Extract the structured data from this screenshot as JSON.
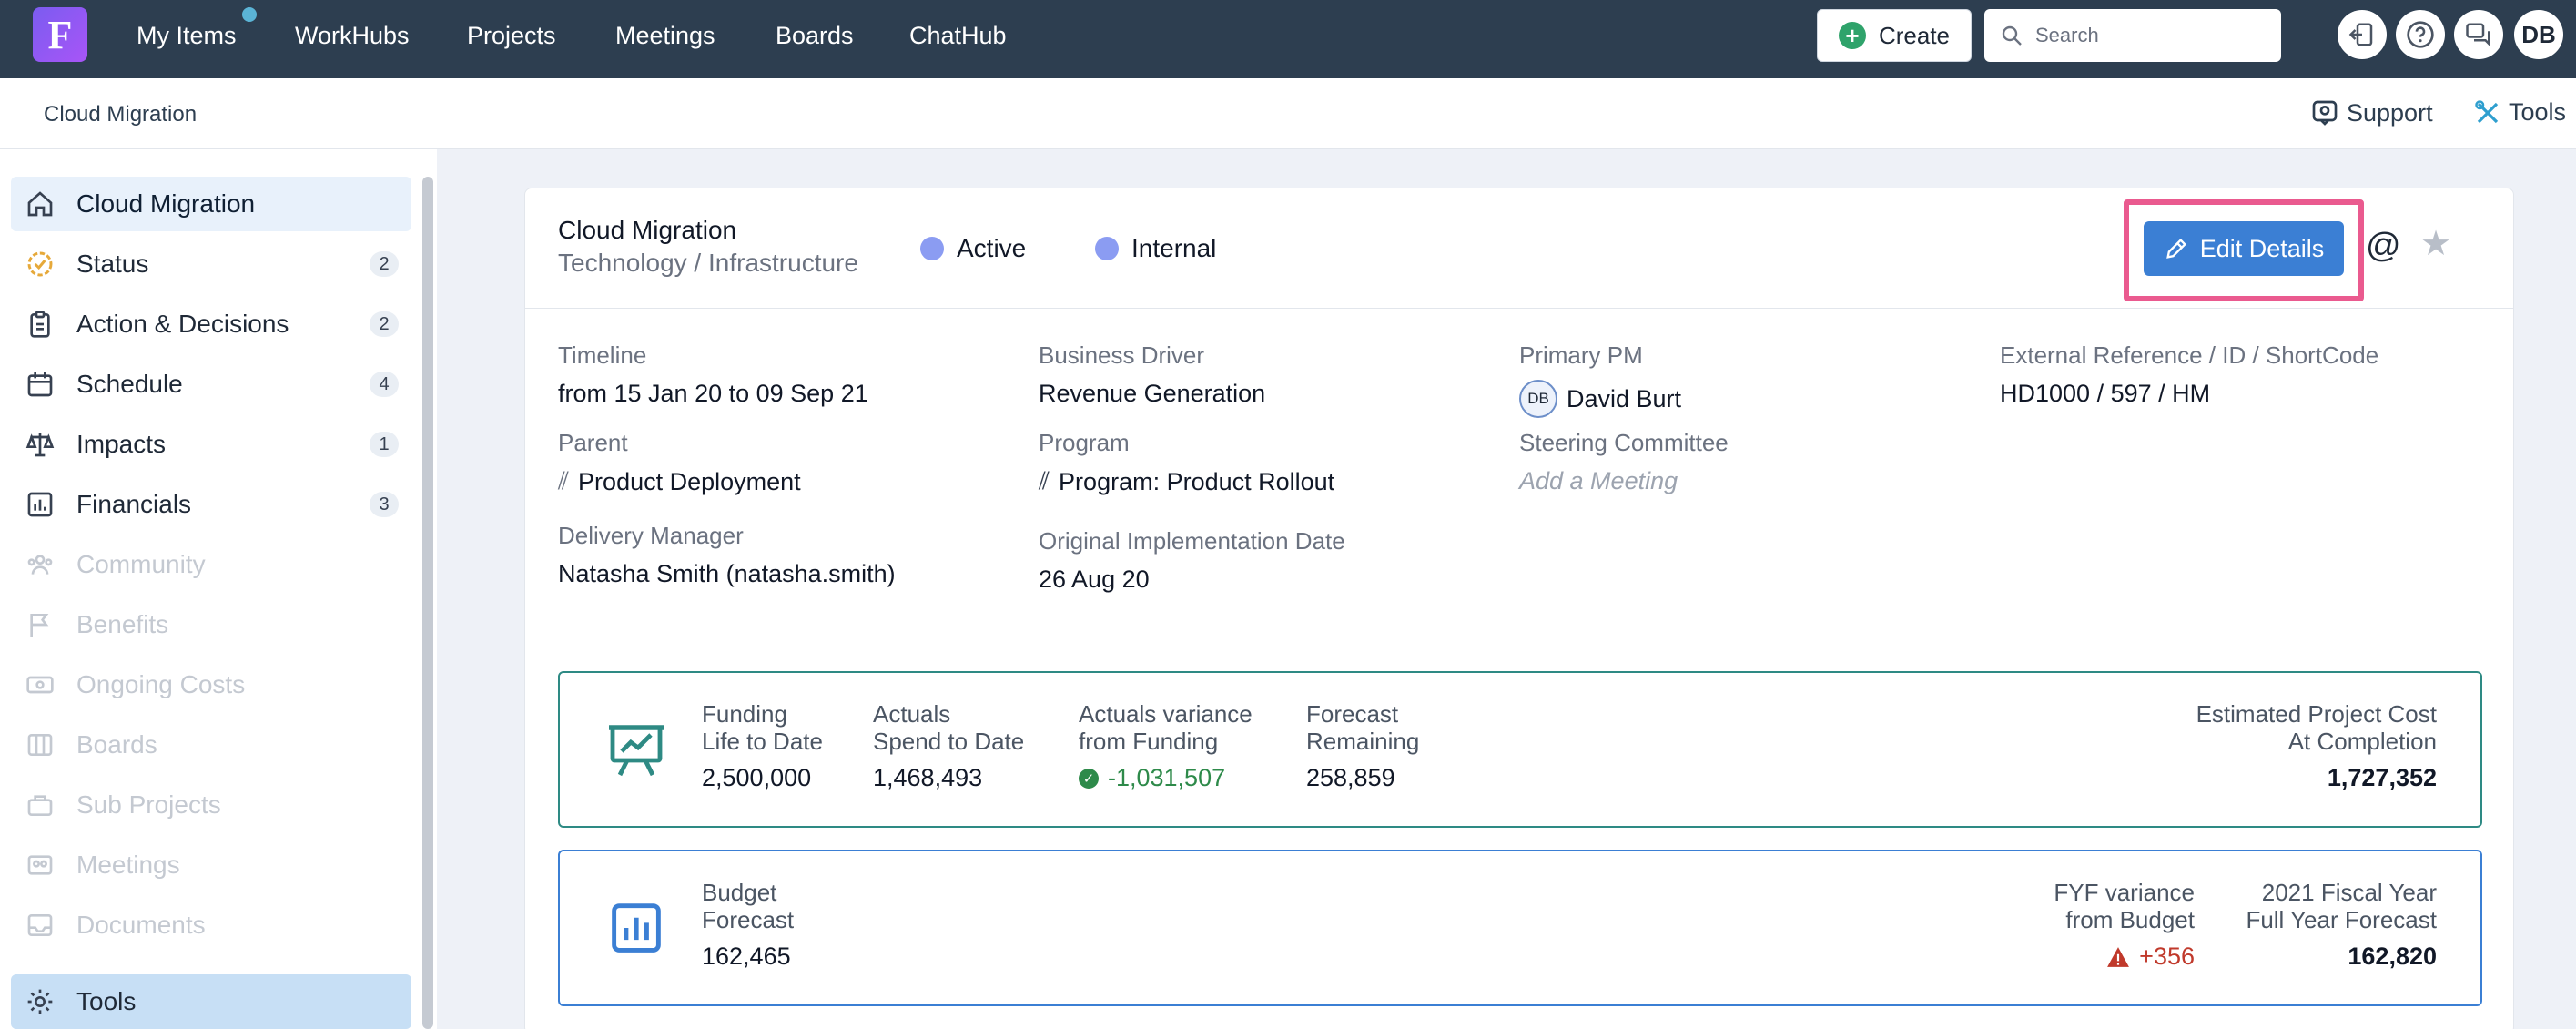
{
  "topnav": {
    "logo_letter": "F",
    "items": [
      {
        "label": "My Items"
      },
      {
        "label": "WorkHubs"
      },
      {
        "label": "Projects"
      },
      {
        "label": "Meetings"
      },
      {
        "label": "Boards"
      },
      {
        "label": "ChatHub"
      }
    ],
    "create_label": "Create",
    "search_placeholder": "Search",
    "user_initials": "DB"
  },
  "subheader": {
    "breadcrumb": "Cloud Migration",
    "support_label": "Support",
    "tools_label": "Tools"
  },
  "sidebar": {
    "items": [
      {
        "label": "Cloud Migration",
        "icon": "home-icon",
        "badge": ""
      },
      {
        "label": "Status",
        "icon": "status-icon",
        "badge": "2"
      },
      {
        "label": "Action & Decisions",
        "icon": "clipboard-icon",
        "badge": "2"
      },
      {
        "label": "Schedule",
        "icon": "calendar-icon",
        "badge": "4"
      },
      {
        "label": "Impacts",
        "icon": "scale-icon",
        "badge": "1"
      },
      {
        "label": "Financials",
        "icon": "chart-icon",
        "badge": "3"
      },
      {
        "label": "Community",
        "icon": "people-icon",
        "badge": ""
      },
      {
        "label": "Benefits",
        "icon": "flag-icon",
        "badge": ""
      },
      {
        "label": "Ongoing Costs",
        "icon": "money-icon",
        "badge": ""
      },
      {
        "label": "Boards",
        "icon": "columns-icon",
        "badge": ""
      },
      {
        "label": "Sub Projects",
        "icon": "briefcase-icon",
        "badge": ""
      },
      {
        "label": "Meetings",
        "icon": "group-icon",
        "badge": ""
      },
      {
        "label": "Documents",
        "icon": "inbox-icon",
        "badge": ""
      },
      {
        "label": "Tools",
        "icon": "gear-icon",
        "badge": ""
      }
    ]
  },
  "project": {
    "title": "Cloud Migration",
    "subtitle": "Technology / Infrastructure",
    "status": "Active",
    "visibility": "Internal",
    "edit_label": "Edit Details"
  },
  "details": {
    "timeline_label": "Timeline",
    "timeline_value": "from 15 Jan 20 to 09 Sep 21",
    "parent_label": "Parent",
    "parent_value": "Product Deployment",
    "delivery_label": "Delivery Manager",
    "delivery_value": "Natasha Smith (natasha.smith)",
    "driver_label": "Business Driver",
    "driver_value": "Revenue Generation",
    "program_label": "Program",
    "program_value": "Program: Product Rollout",
    "impl_label": "Original Implementation Date",
    "impl_value": "26 Aug 20",
    "pm_label": "Primary PM",
    "pm_initials": "DB",
    "pm_value": "David Burt",
    "steering_label": "Steering Committee",
    "steering_placeholder": "Add a Meeting",
    "extref_label": "External Reference / ID / ShortCode",
    "extref_value": "HD1000 / 597 / HM"
  },
  "funding": {
    "funding_l1": "Funding",
    "funding_l2": "Life to Date",
    "funding_value": "2,500,000",
    "actuals_l1": "Actuals",
    "actuals_l2": "Spend to Date",
    "actuals_value": "1,468,493",
    "variance_l1": "Actuals variance",
    "variance_l2": "from Funding",
    "variance_value": "-1,031,507",
    "forecast_l1": "Forecast",
    "forecast_l2": "Remaining",
    "forecast_value": "258,859",
    "estimate_l1": "Estimated Project Cost",
    "estimate_l2": "At Completion",
    "estimate_value": "1,727,352"
  },
  "budget": {
    "budget_l1": "Budget",
    "budget_l2": "Forecast",
    "budget_value": "162,465",
    "fyf_l1": "FYF variance",
    "fyf_l2": "from Budget",
    "fyf_value": "+356",
    "fiscal_l1": "2021 Fiscal Year",
    "fiscal_l2": "Full Year Forecast",
    "fiscal_value": "162,820"
  },
  "colors": {
    "nav_bg": "#2d3e50",
    "accent": "#3b7fd4",
    "highlight": "#ea5a8f",
    "funding_border": "#2e8a84"
  }
}
